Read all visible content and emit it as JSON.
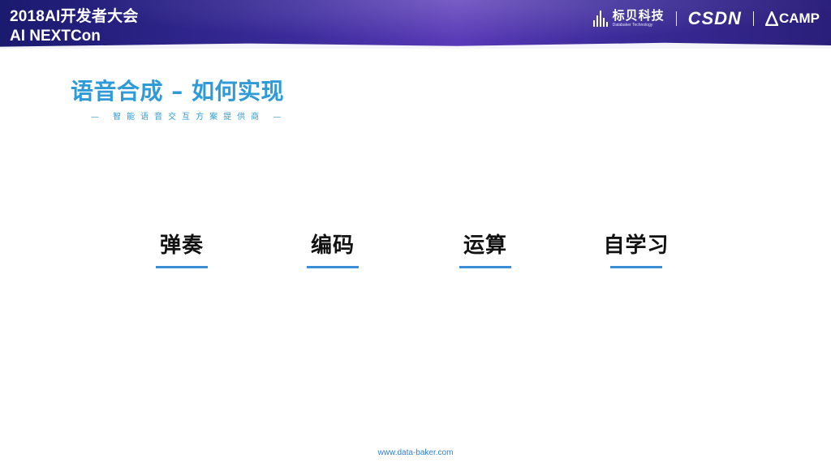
{
  "header": {
    "conference_title": "2018AI开发者大会",
    "conference_subtitle": "AI NEXTCon",
    "logos": {
      "biaobei": {
        "name": "标贝科技",
        "tagline": "Databaker Technology"
      },
      "csdn": "CSDN",
      "camp": "CAMP"
    }
  },
  "slide": {
    "title": "语音合成 – 如何实现",
    "subtitle": "— 智能语音交互方案提供商 —",
    "items": [
      {
        "label": "弹奏"
      },
      {
        "label": "编码"
      },
      {
        "label": "运算"
      },
      {
        "label": "自学习"
      }
    ]
  },
  "footer": {
    "url": "www.data-baker.com"
  },
  "colors": {
    "accent_blue": "#2e9bd8",
    "underline_blue": "#3b8fd6",
    "header_gradient_start": "#1a1a6e",
    "header_gradient_mid": "#5a3ab8"
  }
}
